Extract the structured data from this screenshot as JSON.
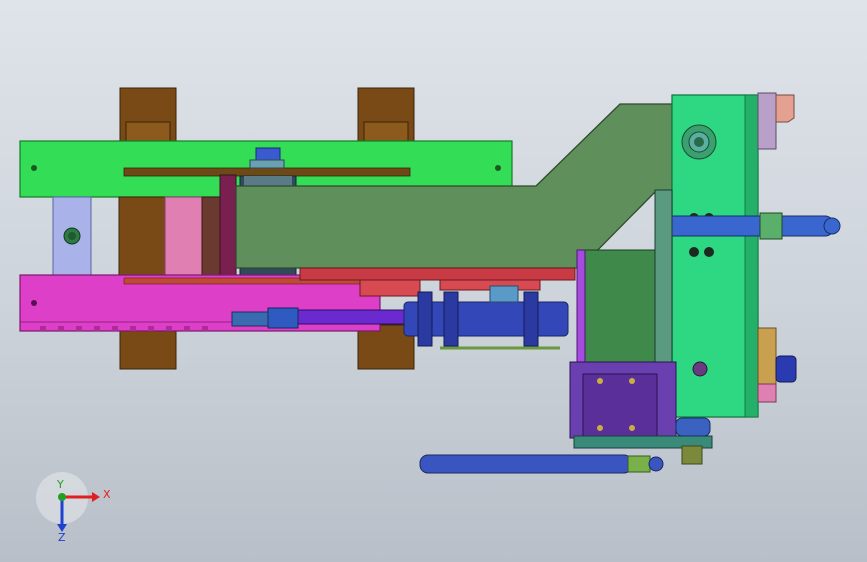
{
  "viewport": {
    "axis_triad": {
      "x_label": "X",
      "y_label": "Y",
      "z_label": "Z",
      "x_color": "#e02020",
      "y_color": "#20a020",
      "z_color": "#2040d0"
    }
  },
  "colors": {
    "background_top": "#dfe4ea",
    "background_bottom": "#b8bfc8",
    "frame_green": "#33dd55",
    "frame_magenta": "#dd3fc8",
    "arm_olive": "#5f8f5b",
    "plate_green": "#2ed882",
    "brown_blocks": "#7a4a16",
    "cylinder_blue": "#3447b8",
    "pink_block": "#e07fb2",
    "lavender_block": "#a9b3ea",
    "purple_base": "#6a3fb0"
  }
}
